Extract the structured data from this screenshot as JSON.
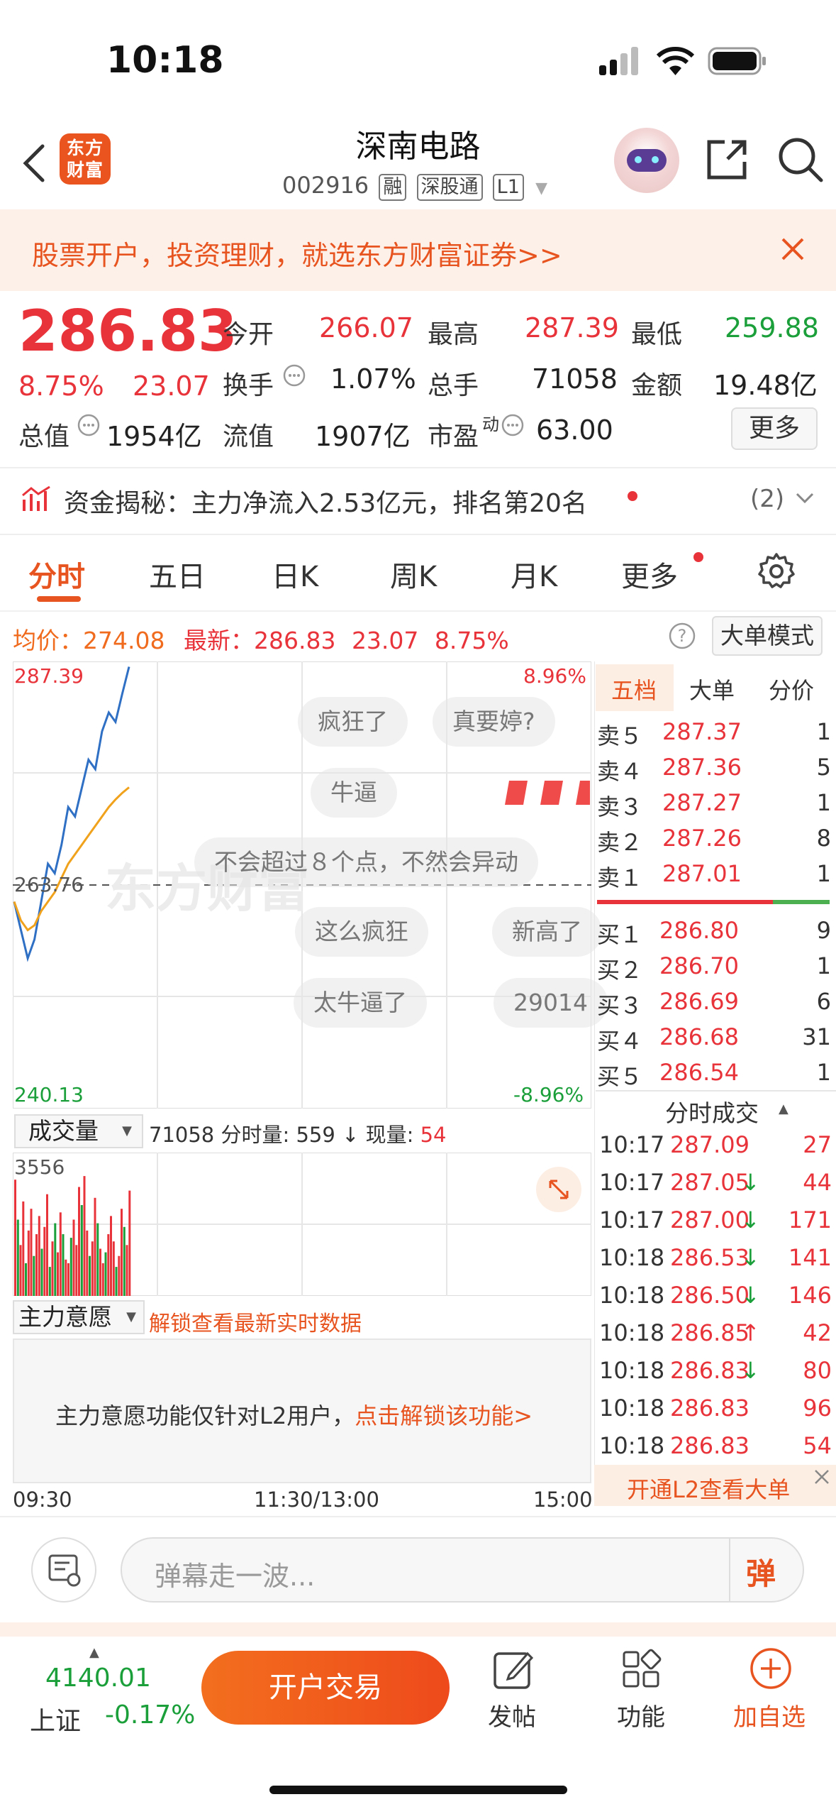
{
  "status": {
    "time": "10:18"
  },
  "header": {
    "title": "深南电路",
    "code": "002916",
    "tags": [
      "融",
      "深股通",
      "L1"
    ],
    "logo_text": "东方财富"
  },
  "banner": {
    "text": "股票开户，投资理财，就选东方财富证券>>"
  },
  "quote": {
    "price": "286.83",
    "change_pct": "8.75%",
    "change": "23.07",
    "open_label": "今开",
    "open": "266.07",
    "high_label": "最高",
    "high": "287.39",
    "low_label": "最低",
    "low": "259.88",
    "turnover_label": "换手",
    "turnover": "1.07%",
    "volume_label": "总手",
    "volume": "71058",
    "amount_label": "金额",
    "amount": "19.48亿",
    "mktcap_label": "总值",
    "mktcap": "1954亿",
    "float_label": "流值",
    "float": "1907亿",
    "pe_label": "市盈",
    "pe_sup": "动",
    "pe": "63.00",
    "more": "更多"
  },
  "fund": {
    "text": "资金揭秘：主力净流入2.53亿元，排名第20名",
    "count": "(2)"
  },
  "tabs": [
    "分时",
    "五日",
    "日K",
    "周K",
    "月K",
    "更多"
  ],
  "chart_info": {
    "avg_label": "均价：",
    "avg": "274.08",
    "last_label": "最新：",
    "last": "286.83",
    "chg": "23.07",
    "pct": "8.75%",
    "mode_button": "大单模式"
  },
  "chart_data": {
    "type": "line",
    "x_labels": [
      "09:30",
      "11:30/13:00",
      "15:00"
    ],
    "ylim": [
      240.13,
      287.39
    ],
    "y_ticks_left": [
      "287.39",
      "263.76",
      "240.13"
    ],
    "y_ticks_right": [
      "8.96%",
      "-8.96%"
    ],
    "series": [
      {
        "values": [
          262,
          259,
          256,
          258,
          262,
          266,
          265,
          268,
          272,
          271,
          274,
          277,
          276,
          280,
          282,
          281,
          284,
          286.83
        ]
      },
      {
        "values": [
          262,
          260,
          259,
          259.5,
          261,
          262,
          263,
          264.5,
          266,
          267,
          268,
          269,
          270,
          271,
          272,
          272.8,
          273.5,
          274.08
        ]
      }
    ],
    "volume": {
      "label": "成交量",
      "max_label": "3556",
      "total": "71058",
      "minute_label": "分时量:",
      "minute": "559",
      "current_label": "现量:",
      "current": "54",
      "bars": [
        3200,
        2100,
        1400,
        2600,
        900,
        1800,
        2400,
        1100,
        1700,
        2200,
        1300,
        1900,
        2800,
        800,
        1500,
        2000,
        1200,
        2300,
        1700,
        1000,
        900,
        1600,
        2100,
        1400,
        3000,
        2500,
        3300,
        1800,
        1100,
        1500,
        2700,
        2000,
        1300,
        900,
        1200,
        1700,
        2200,
        1500,
        800,
        1100,
        2400,
        1900,
        1400,
        2900
      ],
      "bar_up": [
        true,
        false,
        true,
        true,
        false,
        true,
        true,
        false,
        true,
        true,
        false,
        true,
        true,
        false,
        true,
        false,
        true,
        true,
        false,
        true,
        true,
        false,
        true,
        true,
        true,
        false,
        true,
        true,
        false,
        true,
        true,
        false,
        true,
        true,
        false,
        true,
        true,
        true,
        false,
        true,
        true,
        false,
        true,
        true
      ]
    }
  },
  "danmaku": [
    "疯狂了",
    "真要婷?",
    "牛逼",
    "不会超过８个点，不然会异动",
    "这么疯狂",
    "新高了",
    "太牛逼了",
    "29014"
  ],
  "watermark": "东方财富",
  "orderbook": {
    "tabs": [
      "五档",
      "大单",
      "分价"
    ],
    "asks": [
      {
        "label": "卖５",
        "price": "287.37",
        "vol": "1"
      },
      {
        "label": "卖４",
        "price": "287.36",
        "vol": "5"
      },
      {
        "label": "卖３",
        "price": "287.27",
        "vol": "1"
      },
      {
        "label": "卖２",
        "price": "287.26",
        "vol": "8"
      },
      {
        "label": "卖１",
        "price": "287.01",
        "vol": "1"
      }
    ],
    "bids": [
      {
        "label": "买１",
        "price": "286.80",
        "vol": "9"
      },
      {
        "label": "买２",
        "price": "286.70",
        "vol": "1"
      },
      {
        "label": "买３",
        "price": "286.69",
        "vol": "6"
      },
      {
        "label": "买４",
        "price": "286.68",
        "vol": "31"
      },
      {
        "label": "买５",
        "price": "286.54",
        "vol": "1"
      }
    ]
  },
  "trades": {
    "title": "分时成交",
    "rows": [
      {
        "time": "10:17",
        "price": "287.09",
        "arrow": "",
        "vol": "27"
      },
      {
        "time": "10:17",
        "price": "287.05",
        "arrow": "↓",
        "vol": "44"
      },
      {
        "time": "10:17",
        "price": "287.00",
        "arrow": "↓",
        "vol": "171"
      },
      {
        "time": "10:18",
        "price": "286.53",
        "arrow": "↓",
        "vol": "141"
      },
      {
        "time": "10:18",
        "price": "286.50",
        "arrow": "↓",
        "vol": "146"
      },
      {
        "time": "10:18",
        "price": "286.85",
        "arrow": "↑",
        "vol": "42"
      },
      {
        "time": "10:18",
        "price": "286.83",
        "arrow": "↓",
        "vol": "80"
      },
      {
        "time": "10:18",
        "price": "286.83",
        "arrow": "",
        "vol": "96"
      },
      {
        "time": "10:18",
        "price": "286.83",
        "arrow": "",
        "vol": "54"
      }
    ],
    "l2": "开通L2查看大单"
  },
  "main_force": {
    "label": "主力意愿",
    "unlock": "解锁查看最新实时数据",
    "notice": "主力意愿功能仅针对L2用户，",
    "notice_link": "点击解锁该功能>"
  },
  "comment": {
    "placeholder": "弹幕走一波...",
    "danmu_icon": "弹"
  },
  "bottom": {
    "index_value": "4140.01",
    "index_name": "上证",
    "index_pct": "-0.17%",
    "trade_button": "开户交易",
    "post": "发帖",
    "func": "功能",
    "add": "加自选"
  }
}
